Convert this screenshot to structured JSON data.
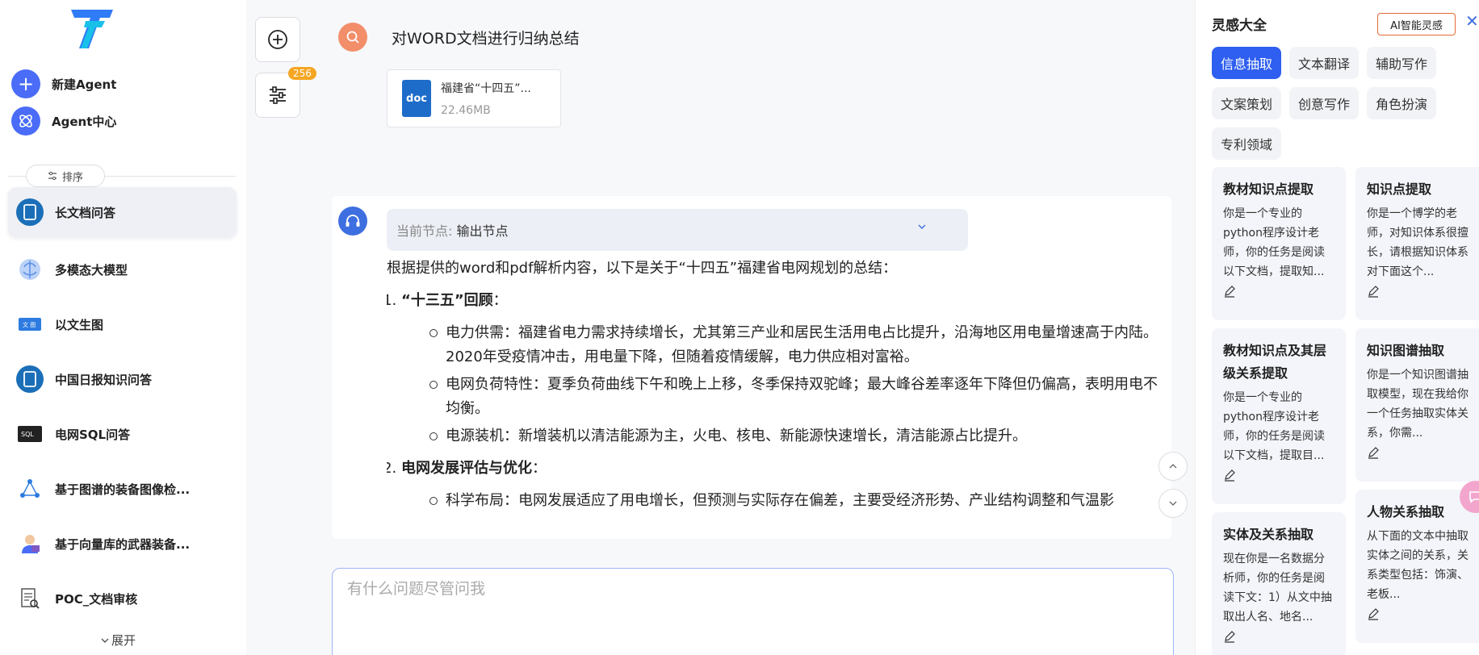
{
  "sidebar": {
    "actions": [
      {
        "label": "新建Agent",
        "icon": "plus-icon"
      },
      {
        "label": "Agent中心",
        "icon": "atom-icon"
      }
    ],
    "sort_label": "排序",
    "agents": [
      {
        "label": "长文档问答",
        "icon": "book-icon",
        "active": true
      },
      {
        "label": "多模态大模型",
        "icon": "brain-icon"
      },
      {
        "label": "以文生图",
        "icon": "text-image-icon"
      },
      {
        "label": "中国日报知识问答",
        "icon": "book-icon"
      },
      {
        "label": "电网SQL问答",
        "icon": "sql-icon"
      },
      {
        "label": "基于图谱的装备图像检...",
        "icon": "graph-icon"
      },
      {
        "label": "基于向量库的武器装备...",
        "icon": "person-icon"
      },
      {
        "label": "POC_文档审核",
        "icon": "document-review-icon"
      }
    ],
    "expand_label": "展开"
  },
  "tools": {
    "badge_count": "256"
  },
  "chat": {
    "user_question": "对WORD文档进行归纳总结",
    "file": {
      "name": "福建省“十四五”...",
      "size": "22.46MB",
      "type_label": "doc"
    },
    "node_key": "当前节点:",
    "node_value": "输出节点",
    "intro": "根据提供的word和pdf解析内容，以下是关于“十四五”福建省电网规划的总结：",
    "sections": [
      {
        "head": "“十三五”回顾",
        "bullets": [
          "电力供需：福建省电力需求持续增长，尤其第三产业和居民生活用电占比提升，沿海地区用电量增速高于内陆。2020年受疫情冲击，用电量下降，但随着疫情缓解，电力供应相对富裕。",
          "电网负荷特性：夏季负荷曲线下午和晚上上移，冬季保持双驼峰；最大峰谷差率逐年下降但仍偏高，表明用电不均衡。",
          "电源装机：新增装机以清洁能源为主，火电、核电、新能源快速增长，清洁能源占比提升。"
        ]
      },
      {
        "head": "电网发展评估与优化",
        "bullets": [
          "科学布局：电网发展适应了用电增长，但预测与实际存在偏差，主要受经济形势、产业结构调整和气温影"
        ]
      }
    ],
    "input_placeholder": "有什么问题尽管问我"
  },
  "right_panel": {
    "title": "灵感大全",
    "ai_button": "AI智能灵感",
    "tags": [
      "信息抽取",
      "文本翻译",
      "辅助写作",
      "文案策划",
      "创意写作",
      "角色扮演",
      "专利领域"
    ],
    "active_tag": "信息抽取",
    "cards": [
      {
        "title": "教材知识点提取",
        "desc": "你是一个专业的python程序设计老师，你的任务是阅读以下文档，提取知..."
      },
      {
        "title": "知识点提取",
        "desc": "你是一个博学的老师，对知识体系很擅长，请根据知识体系对下面这个..."
      },
      {
        "title": "教材知识点及其层级关系提取",
        "desc": "你是一个专业的python程序设计老师，你的任务是阅读以下文档，提取目..."
      },
      {
        "title": "知识图谱抽取",
        "desc": "你是一个知识图谱抽取模型，现在我给你一个任务抽取实体关系，你需..."
      },
      {
        "title": "实体及关系抽取",
        "desc": "现在你是一名数据分析师，你的任务是阅读下文：1）从文中抽取出人名、地名..."
      },
      {
        "title": "人物关系抽取",
        "desc": "从下面的文本中抽取实体之间的关系，关系类型包括：饰演、老板..."
      }
    ]
  },
  "colors": {
    "accent": "#2f5ff0",
    "badge": "#f5a623",
    "avatar_user": "#f28e6a"
  }
}
